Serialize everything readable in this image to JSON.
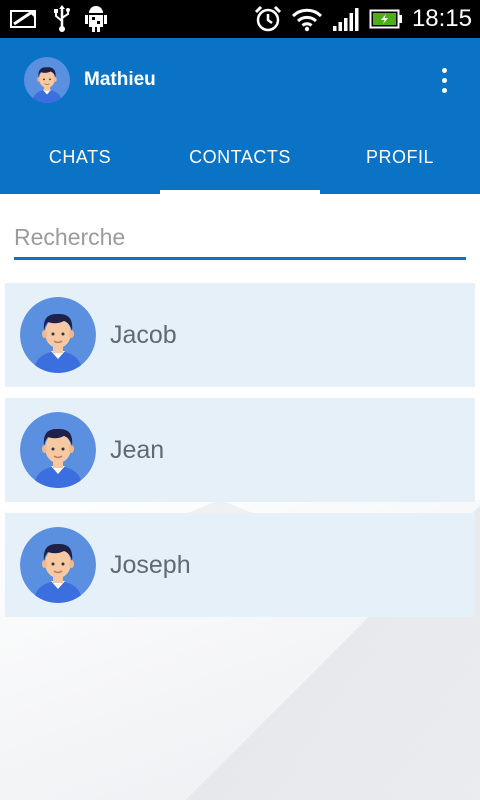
{
  "status_bar": {
    "time": "18:15",
    "left_icons": [
      "message-icon",
      "usb-icon",
      "android-debug-icon"
    ],
    "right_icons": [
      "alarm-icon",
      "wifi-icon",
      "signal-icon",
      "battery-charging-icon"
    ]
  },
  "toolbar": {
    "title": "Mathieu",
    "avatar_icon": "user-avatar-icon",
    "menu_icon": "overflow-menu-icon"
  },
  "tabs": [
    {
      "label": "CHATS",
      "active": false
    },
    {
      "label": "CONTACTS",
      "active": true
    },
    {
      "label": "PROFIL",
      "active": false
    }
  ],
  "search": {
    "placeholder": "Recherche",
    "value": ""
  },
  "contacts": [
    {
      "name": "Jacob"
    },
    {
      "name": "Jean"
    },
    {
      "name": "Joseph"
    }
  ],
  "colors": {
    "primary": "#0a73c6",
    "list_item_bg": "#e5f0f8",
    "status_bar": "#000000",
    "battery_green": "#4caf1a"
  }
}
